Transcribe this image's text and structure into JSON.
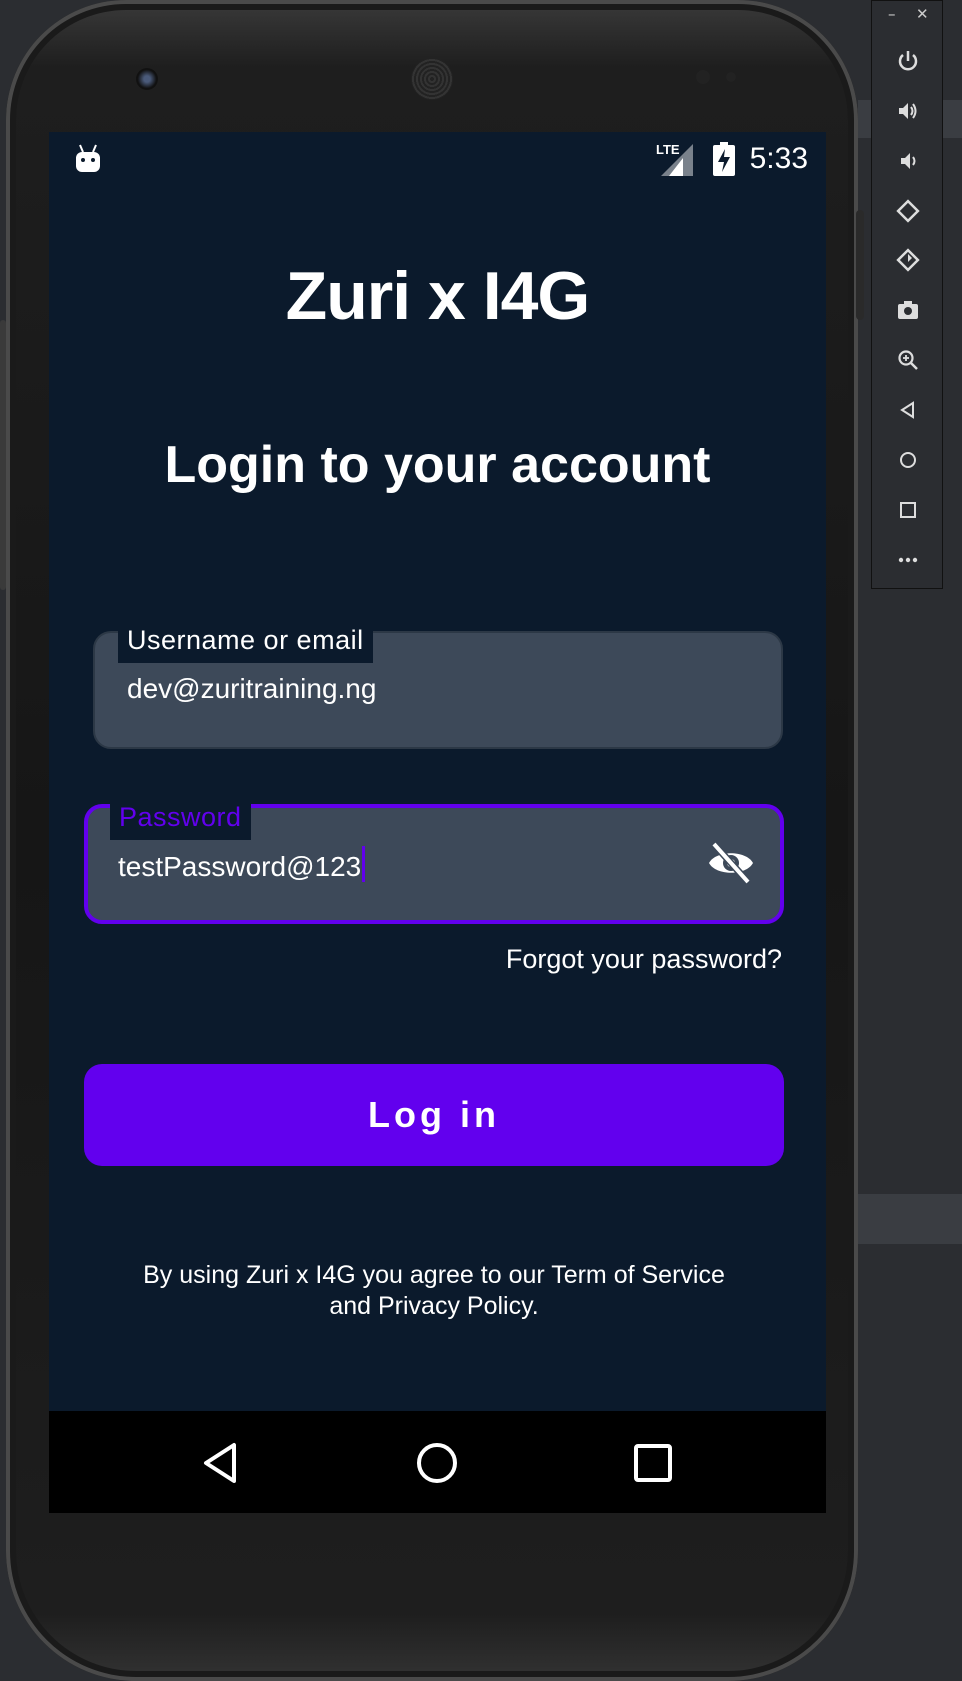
{
  "app": {
    "title": "Zuri x I4G",
    "heading": "Login to your account"
  },
  "status_bar": {
    "time": "5:33",
    "network": "LTE"
  },
  "username_field": {
    "label": "Username or email",
    "value": "dev@zuritraining.ng"
  },
  "password_field": {
    "label": "Password",
    "value": "testPassword@123",
    "visibility_icon": "eye-off-icon"
  },
  "forgot_password": "Forgot your password?",
  "login_button": "Log in",
  "terms": {
    "line1": "By using Zuri x I4G you agree to our Term of Service",
    "line2": "and Privacy Policy."
  },
  "colors": {
    "accent": "#6200ee",
    "screen_background": "#0b1a2c",
    "field_background": "#3d4959"
  },
  "nav_bar": [
    "back-icon",
    "home-icon",
    "recents-icon"
  ],
  "emulator_toolbar": [
    "minimize-icon",
    "close-icon",
    "power-icon",
    "volume-up-icon",
    "volume-down-icon",
    "rotate-left-icon",
    "rotate-right-icon",
    "camera-icon",
    "zoom-icon",
    "back-icon",
    "home-icon",
    "overview-icon",
    "more-icon"
  ]
}
